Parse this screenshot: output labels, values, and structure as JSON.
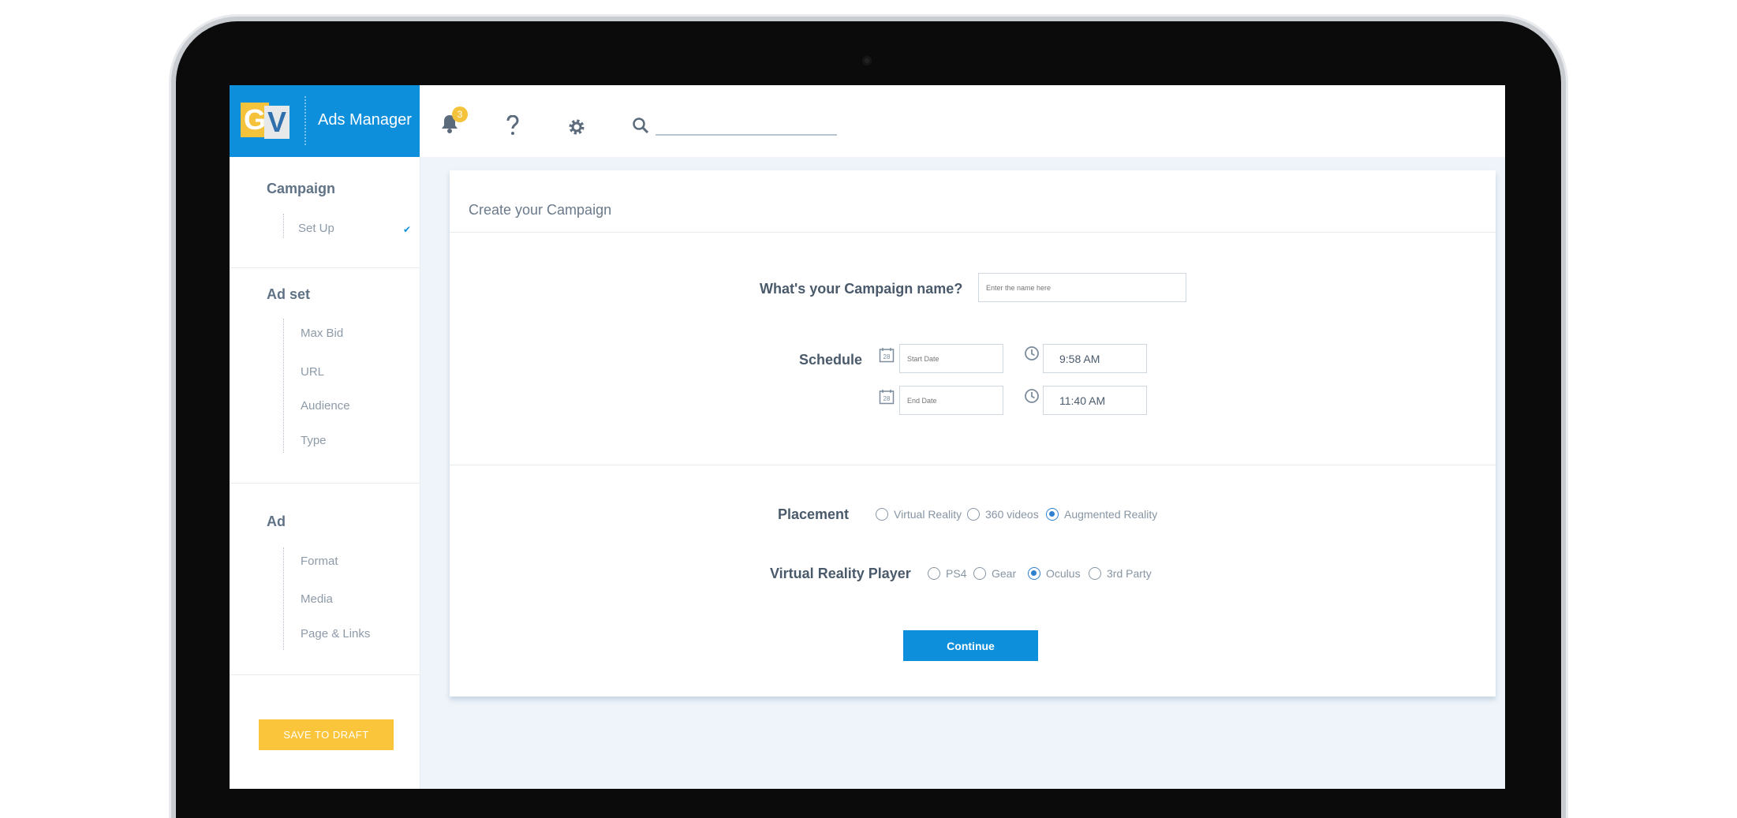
{
  "brand": {
    "logo_g": "G",
    "logo_v": "V",
    "title": "Ads Manager"
  },
  "topbar": {
    "notification_count": "3",
    "search_placeholder": ""
  },
  "sidebar": {
    "campaign": {
      "title": "Campaign",
      "items": [
        "Set Up"
      ]
    },
    "adset": {
      "title": "Ad set",
      "items": [
        "Max Bid",
        "URL",
        "Audience",
        "Type"
      ]
    },
    "ad": {
      "title": "Ad",
      "items": [
        "Format",
        "Media",
        "Page & Links"
      ]
    },
    "save_label": "SAVE TO DRAFT"
  },
  "form": {
    "title": "Create your Campaign",
    "name_label": "What's your Campaign name?",
    "name_placeholder": "Enter the name here",
    "schedule_label": "Schedule",
    "start_placeholder": "Start Date",
    "end_placeholder": "End Date",
    "start_time": "9:58 AM",
    "end_time": "11:40 AM",
    "calendar_day": "28",
    "placement_label": "Placement",
    "placement_options": [
      "Virtual Reality",
      "360 videos",
      "Augmented Reality"
    ],
    "placement_selected": "Augmented Reality",
    "player_label": "Virtual Reality Player",
    "player_options": [
      "PS4",
      "Gear",
      "Oculus",
      "3rd Party"
    ],
    "player_selected": "Oculus",
    "continue_label": "Continue"
  },
  "colors": {
    "primary": "#0d8fdb",
    "accent": "#fac53b",
    "background": "#eff4fa"
  },
  "icons": [
    "bell-icon",
    "help-icon",
    "gear-icon",
    "search-icon",
    "calendar-icon",
    "clock-icon",
    "check-icon"
  ]
}
